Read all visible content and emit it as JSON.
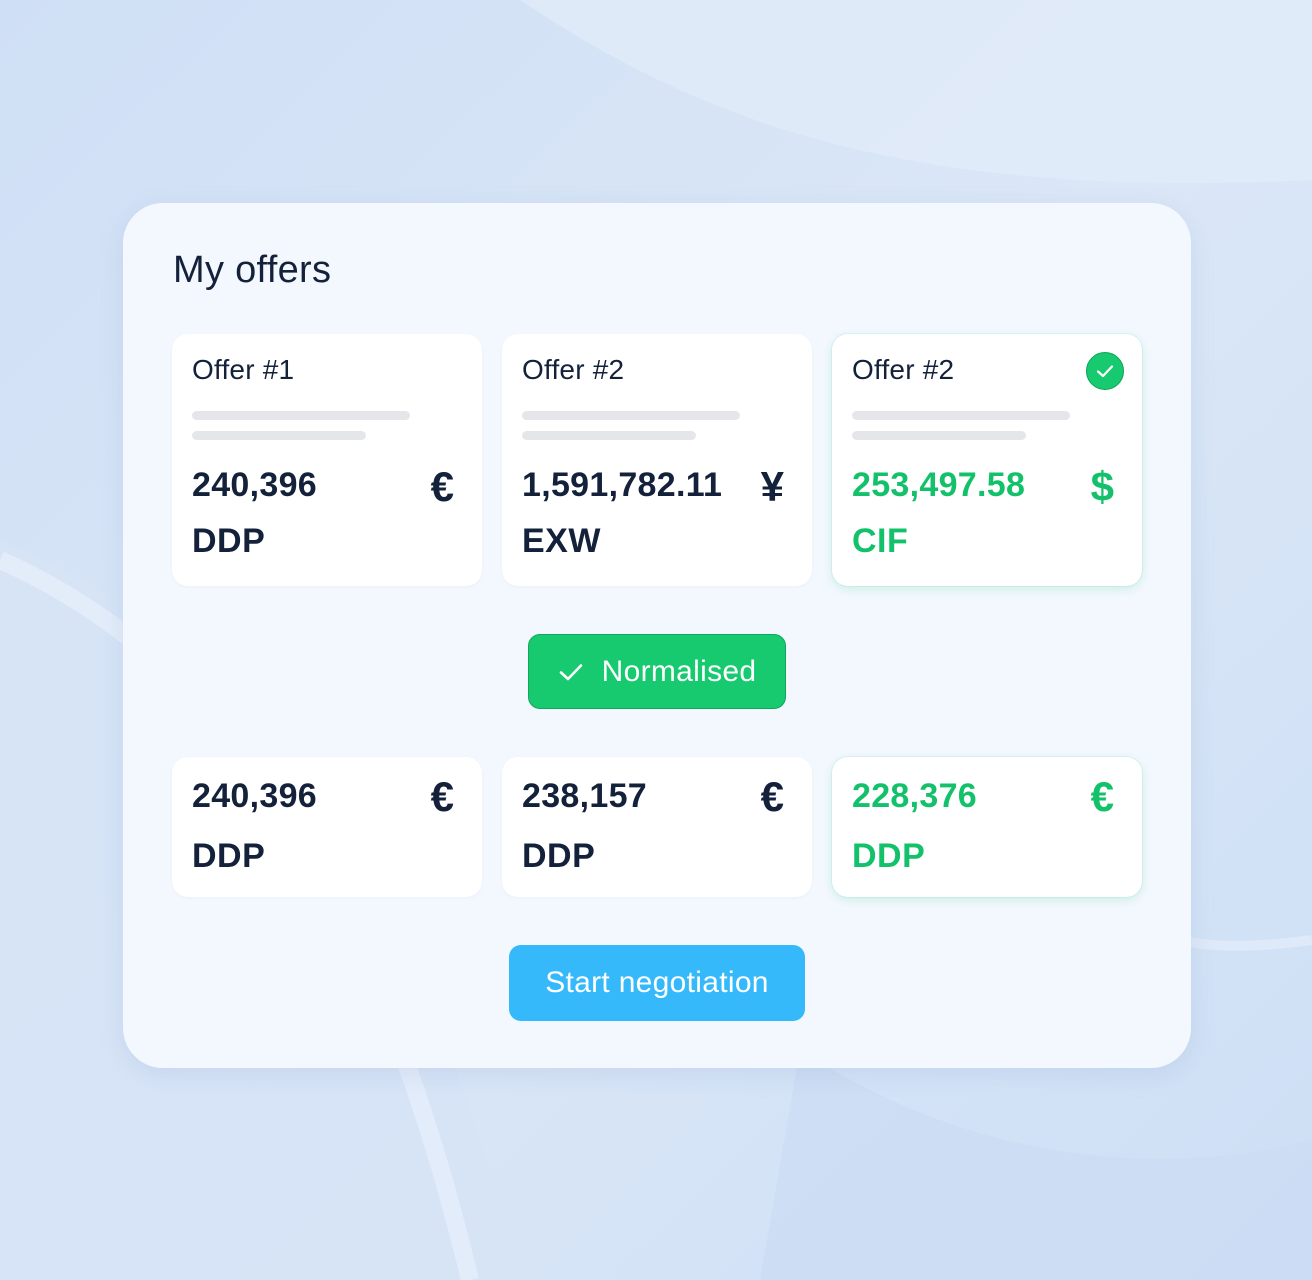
{
  "panel": {
    "title": "My offers"
  },
  "offers": [
    {
      "label": "Offer #1",
      "amount": "240,396",
      "incoterm": "DDP",
      "currency_symbol": "€",
      "selected": false
    },
    {
      "label": "Offer #2",
      "amount": "1,591,782.11",
      "incoterm": "EXW",
      "currency_symbol": "¥",
      "selected": false
    },
    {
      "label": "Offer #2",
      "amount": "253,497.58",
      "incoterm": "CIF",
      "currency_symbol": "$",
      "selected": true
    }
  ],
  "normalised_button": {
    "label": "Normalised",
    "icon": "checkmark-icon"
  },
  "normalised_offers": [
    {
      "amount": "240,396",
      "incoterm": "DDP",
      "currency_symbol": "€",
      "selected": false
    },
    {
      "amount": "238,157",
      "incoterm": "DDP",
      "currency_symbol": "€",
      "selected": false
    },
    {
      "amount": "228,376",
      "incoterm": "DDP",
      "currency_symbol": "€",
      "selected": true
    }
  ],
  "start_button": {
    "label": "Start negotiation"
  },
  "colors": {
    "background": "#d3e2f6",
    "panel": "#f3f8fe",
    "text_dark": "#14213a",
    "accent_green": "#13c16a",
    "button_green": "#17c96f",
    "button_blue": "#36b9fb"
  }
}
